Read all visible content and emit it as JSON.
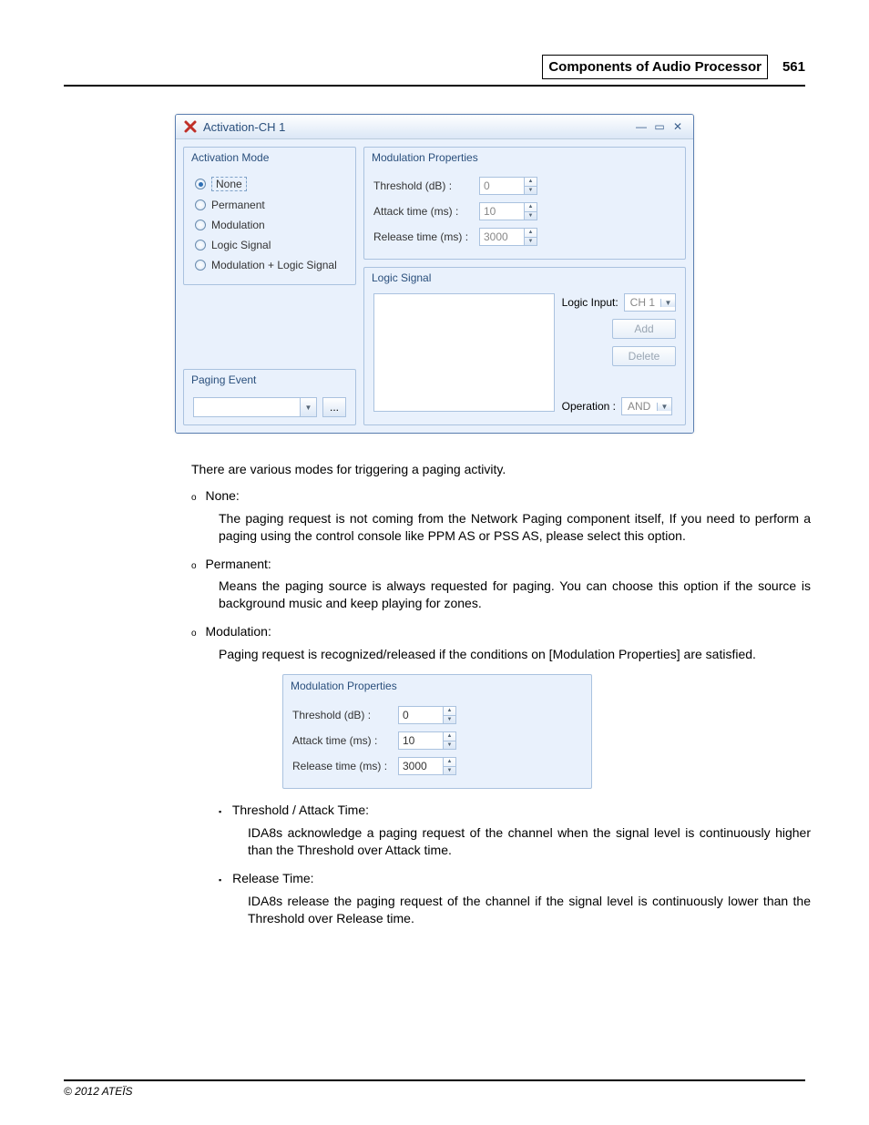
{
  "header": {
    "title": "Components of Audio Processor",
    "page": "561"
  },
  "window": {
    "title": "Activation-CH 1",
    "activation_mode": {
      "legend": "Activation Mode",
      "options": [
        {
          "label": "None",
          "selected": true
        },
        {
          "label": "Permanent",
          "selected": false
        },
        {
          "label": "Modulation",
          "selected": false
        },
        {
          "label": "Logic Signal",
          "selected": false
        },
        {
          "label": "Modulation + Logic Signal",
          "selected": false
        }
      ]
    },
    "paging_event": {
      "legend": "Paging Event",
      "more": "..."
    },
    "modulation": {
      "legend": "Modulation Properties",
      "threshold_label": "Threshold (dB) :",
      "threshold_value": "0",
      "attack_label": "Attack time (ms) :",
      "attack_value": "10",
      "release_label": "Release time (ms) :",
      "release_value": "3000"
    },
    "logic": {
      "legend": "Logic Signal",
      "input_label": "Logic Input:",
      "input_value": "CH 1",
      "add": "Add",
      "delete": "Delete",
      "operation_label": "Operation :",
      "operation_value": "AND"
    }
  },
  "doc": {
    "intro": "There are various modes for triggering a paging activity.",
    "items": [
      {
        "title": "None:",
        "body": "The paging request is not coming from the Network Paging component itself, If you need to perform a paging using the control console like PPM AS or PSS AS, please select this option."
      },
      {
        "title": "Permanent:",
        "body": "Means the paging source is always requested for paging. You can choose this option if the source is background music and keep playing for zones."
      },
      {
        "title": "Modulation:",
        "body": "Paging request is recognized/released if the conditions on [Modulation Properties] are satisfied."
      }
    ],
    "sub": [
      {
        "title": "Threshold / Attack Time:",
        "body": "IDA8s acknowledge a paging request of the channel when the signal level is continuously higher than the Threshold over Attack time."
      },
      {
        "title": "Release Time:",
        "body": "IDA8s release the paging request of the channel if the signal level is continuously lower than the Threshold over Release time."
      }
    ]
  },
  "mod_fig": {
    "legend": "Modulation Properties",
    "threshold_label": "Threshold (dB) :",
    "threshold_value": "0",
    "attack_label": "Attack time (ms) :",
    "attack_value": "10",
    "release_label": "Release time (ms) :",
    "release_value": "3000"
  },
  "footer": "© 2012 ATEÏS"
}
